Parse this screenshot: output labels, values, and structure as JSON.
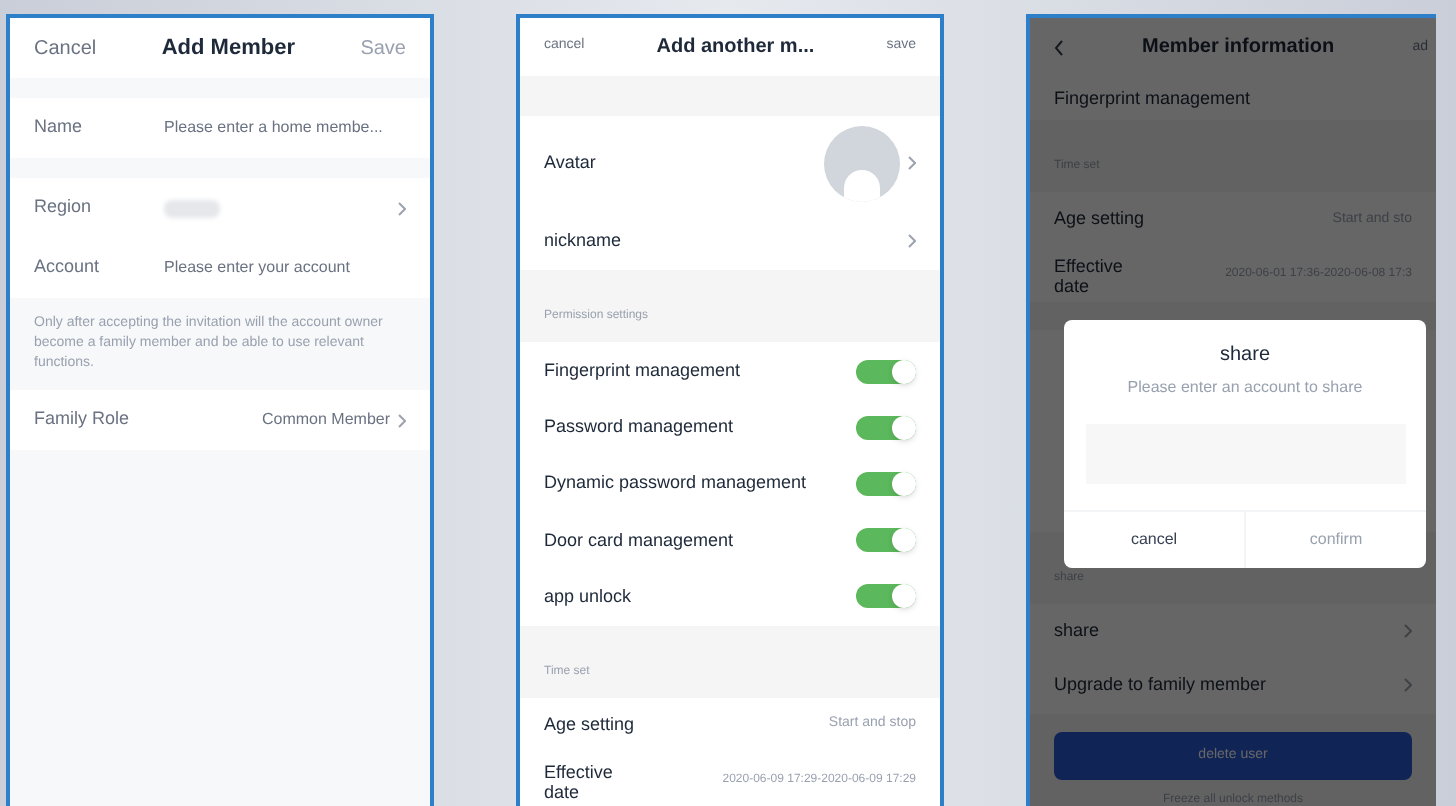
{
  "screens": [
    {
      "kind": "add_member",
      "header": {
        "left": "Cancel",
        "title": "Add Member",
        "right": "Save"
      },
      "fields": [
        {
          "label": "Name",
          "placeholder": "Please enter a home membe...",
          "kind": "input"
        },
        {
          "label": "Region",
          "kind": "select"
        },
        {
          "label": "Account",
          "placeholder": "Please enter your account",
          "kind": "input"
        }
      ],
      "note": "Only after accepting the invitation will the account owner become a family member and be able to use relevant functions.",
      "role": {
        "label": "Family Role",
        "value": "Common Member"
      }
    },
    {
      "kind": "add_another",
      "header": {
        "left": "cancel",
        "title": "Add another m...",
        "right": "save"
      },
      "avatar_label": "Avatar",
      "nickname_label": "nickname",
      "permissions_title": "Permission settings",
      "permissions": [
        {
          "label": "Fingerprint management",
          "on": true
        },
        {
          "label": "Password management",
          "on": true
        },
        {
          "label": "Dynamic password management",
          "on": true
        },
        {
          "label": "Door card management",
          "on": true
        },
        {
          "label": "app unlock",
          "on": true
        }
      ],
      "time_title": "Time set",
      "age": {
        "label": "Age setting",
        "value": "Start and stop"
      },
      "effective": {
        "label": "Effective date",
        "value": "2020-06-09 17:29-2020-06-09 17:29"
      }
    },
    {
      "kind": "member_info",
      "header": {
        "title": "Member information",
        "right": "ad"
      },
      "top_row": {
        "label": "Fingerprint management"
      },
      "time_title": "Time set",
      "age": {
        "label": "Age setting",
        "value": "Start and sto"
      },
      "effective": {
        "label": "Effective date",
        "value": "2020-06-01 17:36-2020-06-08 17:3"
      },
      "share_title": "share",
      "rows": [
        "share",
        "Upgrade to family member"
      ],
      "delete_button": "delete user",
      "footer": "Freeze all unlock methods",
      "dialog": {
        "title": "share",
        "message": "Please enter an account to share",
        "buttons": [
          "cancel",
          "confirm"
        ]
      }
    }
  ]
}
